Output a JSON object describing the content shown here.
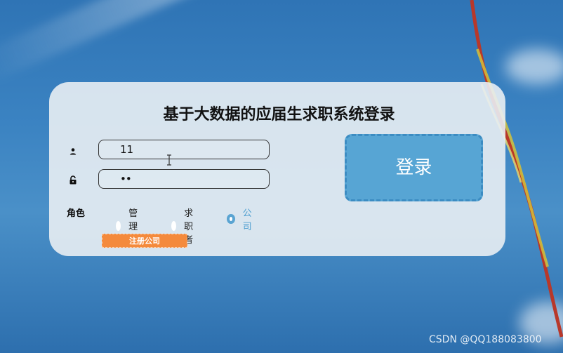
{
  "form": {
    "title": "基于大数据的应届生求职系统登录",
    "username": {
      "value": "11",
      "icon": "user-icon"
    },
    "password": {
      "value": "••",
      "icon": "lock-icon"
    },
    "role": {
      "label": "角色",
      "options": [
        {
          "label": "管理员",
          "selected": false
        },
        {
          "label": "求职者",
          "selected": false
        },
        {
          "label": "公司",
          "selected": true
        }
      ]
    },
    "register_label": "注册公司",
    "login_label": "登录"
  },
  "watermark": "CSDN @QQ188083800",
  "colors": {
    "accent": "#57a5d4",
    "register": "#f48a3c",
    "selected_radio": "#5aa4d2"
  }
}
